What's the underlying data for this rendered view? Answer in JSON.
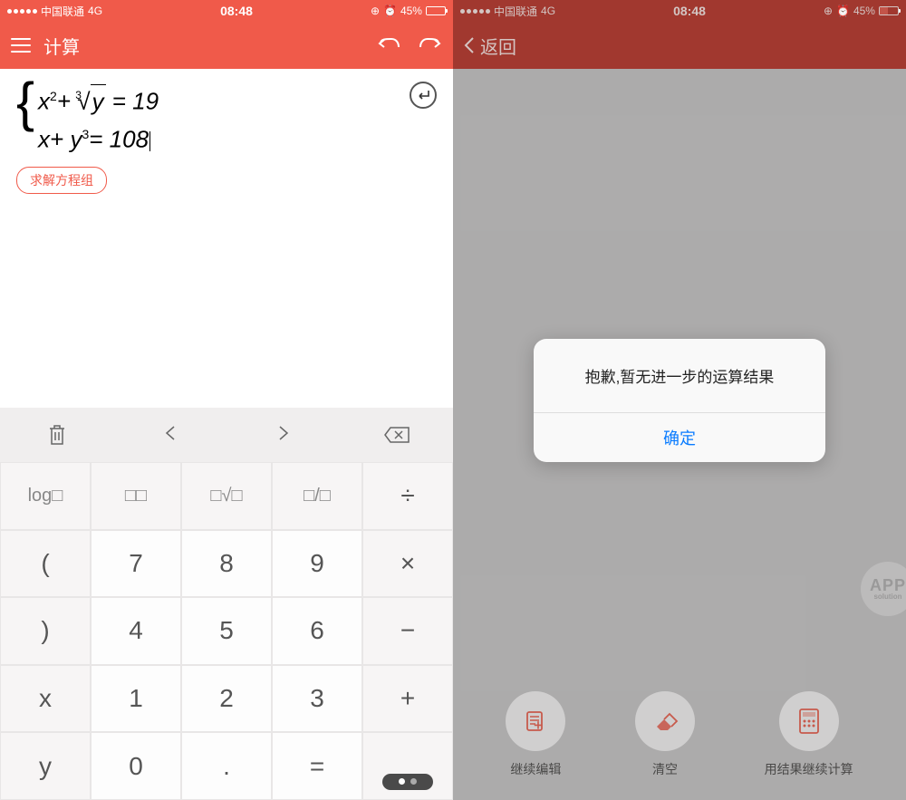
{
  "status": {
    "carrier": "中国联通",
    "network": "4G",
    "time": "08:48",
    "battery_pct": "45%"
  },
  "left": {
    "nav_title": "计算",
    "equation": {
      "line1_part1": "x",
      "line1_sup1": "2",
      "line1_plus": "+ ",
      "line1_root_index": "3",
      "line1_radicand": "y",
      "line1_eq": " = 19",
      "line2_part1": "x+ y",
      "line2_sup": "3",
      "line2_eq": "= 108"
    },
    "solve_label": "求解方程组",
    "toolbar": [
      "trash-icon",
      "nav-left-icon",
      "nav-right-icon",
      "backspace-icon"
    ],
    "keypad": {
      "r0": [
        "log□",
        "□□",
        "□√□",
        "□/□",
        "÷"
      ],
      "r1": [
        "(",
        "7",
        "8",
        "9",
        "×"
      ],
      "r2": [
        ")",
        "4",
        "5",
        "6",
        "−"
      ],
      "r3": [
        "x",
        "1",
        "2",
        "3",
        "+"
      ],
      "r4": [
        "y",
        "0",
        ".",
        "=",
        ""
      ]
    }
  },
  "right": {
    "nav_back": "返回",
    "alert_message": "抱歉,暂无进一步的运算结果",
    "alert_ok": "确定",
    "actions": [
      {
        "label": "继续编辑",
        "icon": "edit-icon"
      },
      {
        "label": "清空",
        "icon": "erase-icon"
      },
      {
        "label": "用结果继续计算",
        "icon": "calculator-icon"
      }
    ],
    "badge": {
      "line1": "APP",
      "line2": "solution"
    }
  }
}
